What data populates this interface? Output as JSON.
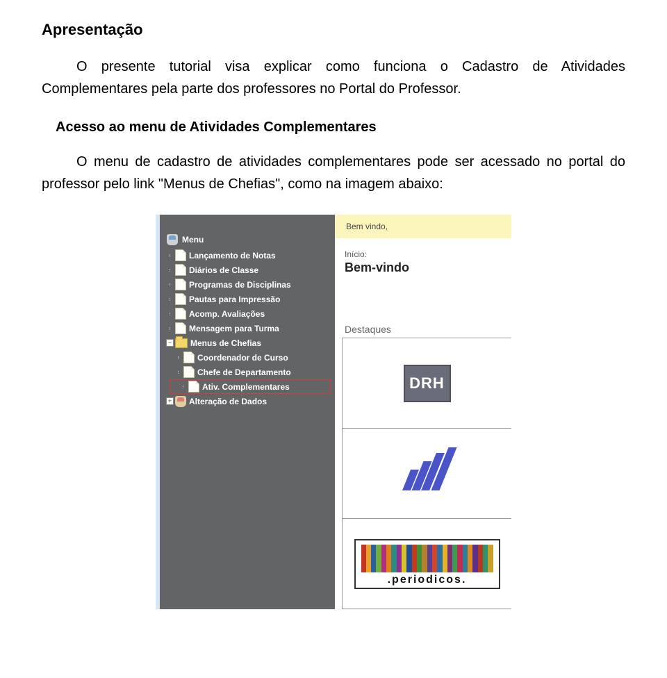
{
  "doc": {
    "h1": "Apresentação",
    "p1": "O presente tutorial visa explicar como funciona o Cadastro de Atividades Complementares pela parte dos professores no Portal do Professor.",
    "h2": "Acesso ao menu de Atividades Complementares",
    "p2": "O menu de cadastro de atividades complementares pode ser acessado no portal do professor pelo link \"Menus de Chefias\", como na imagem abaixo:"
  },
  "shot": {
    "menu_title": "Menu",
    "items": [
      "Lançamento de Notas",
      "Diários de Classe",
      "Programas de Disciplinas",
      "Pautas para Impressão",
      "Acomp. Avaliações",
      "Mensagem para Turma"
    ],
    "chefias_label": "Menus de Chefias",
    "chefias_children": [
      "Coordenador de Curso",
      "Chefe de Departamento",
      "Ativ. Complementares"
    ],
    "alt_dados": "Alteração de Dados",
    "expand_minus": "−",
    "expand_plus": "+",
    "welcome": "Bem vindo,",
    "inicio": "Início:",
    "bemvindo": "Bem-vindo",
    "destaques": "Destaques",
    "drh": "DRH",
    "periodicos": ".periodicos."
  }
}
